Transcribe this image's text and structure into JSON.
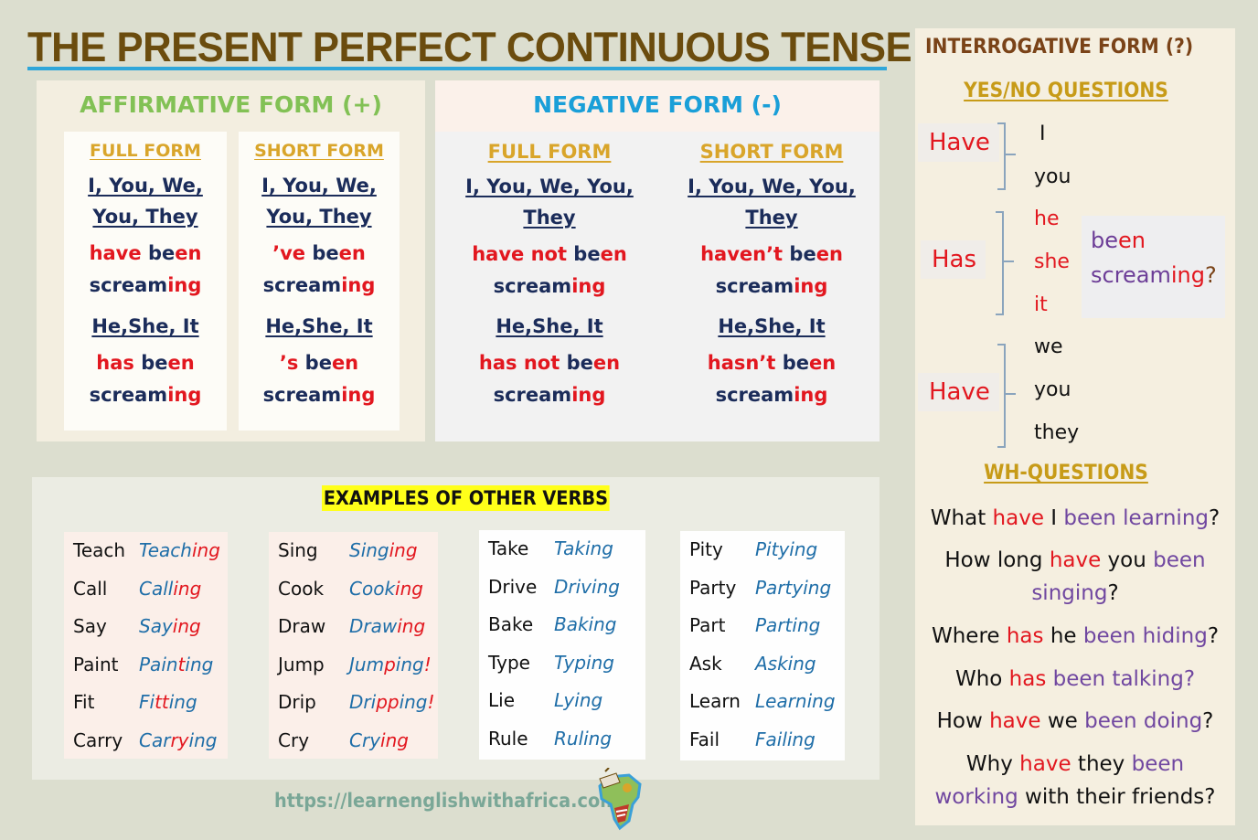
{
  "title": "THE PRESENT PERFECT CONTINUOUS TENSE",
  "colors": {
    "title": "#6b4c0e",
    "title_rule": "#2fa6d9",
    "affirmative": "#82c155",
    "negative": "#1a9fd8",
    "interrogative": "#7a4318",
    "form_label": "#d9a52a",
    "pronoun": "#1b2c5a",
    "red": "#e2171f",
    "purple": "#7047a0",
    "ing_blue": "#1f6ea8",
    "highlight": "#ffff1a"
  },
  "affirmative": {
    "title": "AFFIRMATIVE FORM (+)",
    "full": {
      "label": "FULL FORM",
      "pron1": "I, You, We,",
      "pron1b": "You, They",
      "verb1_aux": "have",
      "pron2": "He,She, It",
      "verb2_aux": "has"
    },
    "short": {
      "label": "SHORT FORM",
      "pron1": "I, You, We,",
      "pron1b": "You, They",
      "verb1_aux": "’ve",
      "pron2": "He,She, It",
      "verb2_aux": "’s"
    }
  },
  "negative": {
    "title": "NEGATIVE FORM (-)",
    "full": {
      "label": "FULL FORM",
      "pron1": "I, You, We, You,",
      "pron1b": "They",
      "verb1_aux": "have not",
      "pron2": "He,She, It",
      "verb2_aux": "has not"
    },
    "short": {
      "label": "SHORT FORM",
      "pron1": "I, You, We, You,",
      "pron1b": "They",
      "verb1_aux": "haven’t",
      "pron2": "He,She, It",
      "verb2_aux": "hasn’t"
    }
  },
  "verb_parts": {
    "be": "be",
    "en": "en",
    "scream": "scream",
    "ing": "ing"
  },
  "interrogative": {
    "title": "INTERROGATIVE FORM (?)",
    "yesno_title": "YES/NO QUESTIONS",
    "groups": [
      {
        "aux": "Have",
        "pronouns": [
          "I",
          "you"
        ]
      },
      {
        "aux": "Has",
        "pronouns": [
          "he",
          "she",
          "it"
        ]
      },
      {
        "aux": "Have",
        "pronouns": [
          "we",
          "you",
          "they"
        ]
      }
    ],
    "been": "been",
    "screaming": "screaming",
    "screaming_ing": "ing",
    "qmark": "?",
    "wh_title": "WH-QUESTIONS",
    "questions": [
      {
        "w": "What ",
        "aux": "have",
        "subj": " I ",
        "p": "been learning",
        "end": "?"
      },
      {
        "w": "How long ",
        "aux": "have",
        "subj": " you ",
        "p": "been",
        "p2": "singing",
        "end": "?"
      },
      {
        "w": "Where ",
        "aux": "has",
        "subj": " he ",
        "p": "been hiding",
        "end": "?"
      },
      {
        "w": "Who ",
        "aux": "has",
        "subj": " ",
        "p": "been talking?",
        "end": ""
      },
      {
        "w": "How ",
        "aux": "have",
        "subj": " we ",
        "p": "been doing",
        "end": "?"
      },
      {
        "w": "Why ",
        "aux": "have",
        "subj": " they ",
        "p": "been",
        "p2": "working",
        "end": " with their friends?"
      }
    ]
  },
  "examples": {
    "title": "EXAMPLES OF OTHER VERBS",
    "groups": [
      [
        {
          "base": "Teach",
          "stem": "Teach",
          "red": "",
          "tail": "",
          "end": "ing"
        },
        {
          "base": "Call",
          "stem": "Call",
          "red": "",
          "tail": "",
          "end": "ing"
        },
        {
          "base": "Say",
          "stem": "Say",
          "red": "",
          "tail": "",
          "end": "ing"
        },
        {
          "base": "Paint",
          "stem": "Pain",
          "red": "t",
          "tail": "ing",
          "end": ""
        },
        {
          "base": "Fit",
          "stem": "Fi",
          "red": "tt",
          "tail": "ing",
          "end": ""
        },
        {
          "base": "Carry",
          "stem": "Car",
          "red": "ry",
          "tail": "ing",
          "end": ""
        }
      ],
      [
        {
          "base": "Sing",
          "stem": "Sing",
          "red": "",
          "tail": "",
          "end": "ing"
        },
        {
          "base": "Cook",
          "stem": "Cook",
          "red": "",
          "tail": "",
          "end": "ing"
        },
        {
          "base": "Draw",
          "stem": "Draw",
          "red": "",
          "tail": "",
          "end": "ing"
        },
        {
          "base": "Jump",
          "stem": "Jum",
          "red": "p",
          "tail": "ing",
          "end": "!"
        },
        {
          "base": "Drip",
          "stem": "Dri",
          "red": "pp",
          "tail": "ing",
          "end": "!"
        },
        {
          "base": "Cry",
          "stem": "Cry",
          "red": "",
          "tail": "",
          "end": "ing"
        }
      ],
      [
        {
          "base": "Take",
          "stem": "Taking",
          "red": "",
          "tail": "",
          "end": ""
        },
        {
          "base": "Drive",
          "stem": "Driving",
          "red": "",
          "tail": "",
          "end": ""
        },
        {
          "base": "Bake",
          "stem": "Baking",
          "red": "",
          "tail": "",
          "end": ""
        },
        {
          "base": "Type",
          "stem": "Typing",
          "red": "",
          "tail": "",
          "end": ""
        },
        {
          "base": "Lie",
          "stem": "Lying",
          "red": "",
          "tail": "",
          "end": ""
        },
        {
          "base": "Rule",
          "stem": "Ruling",
          "red": "",
          "tail": "",
          "end": ""
        }
      ],
      [
        {
          "base": "Pity",
          "stem": "Pitying",
          "red": "",
          "tail": "",
          "end": ""
        },
        {
          "base": "Party",
          "stem": "Partying",
          "red": "",
          "tail": "",
          "end": ""
        },
        {
          "base": "Part",
          "stem": "Parting",
          "red": "",
          "tail": "",
          "end": ""
        },
        {
          "base": "Ask",
          "stem": "Asking",
          "red": "",
          "tail": "",
          "end": ""
        },
        {
          "base": "Learn",
          "stem": "Learning",
          "red": "",
          "tail": "",
          "end": ""
        },
        {
          "base": "Fail",
          "stem": "Failing",
          "red": "",
          "tail": "",
          "end": ""
        }
      ]
    ]
  },
  "footer": {
    "url": "https://learnenglishwithafrica.com",
    "logo_icon": "africa-map-logo"
  }
}
